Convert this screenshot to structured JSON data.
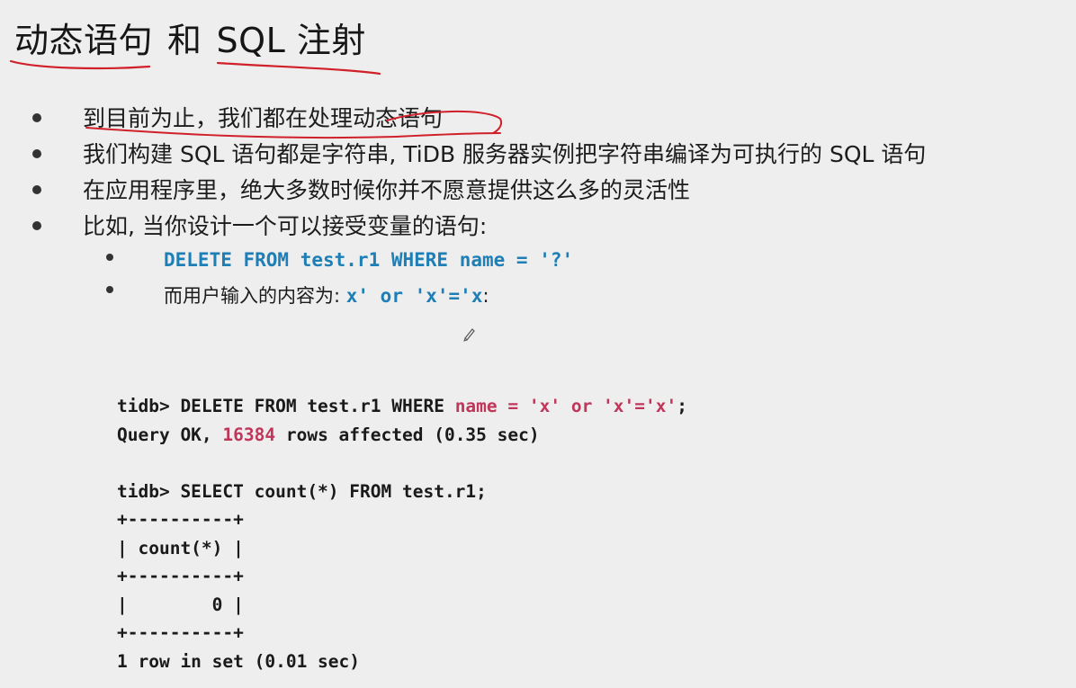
{
  "slide": {
    "title_part1": "动态语句",
    "title_part2": "和",
    "title_part3": "SQL 注射",
    "bullets": [
      "到目前为止，我们都在处理动态语句",
      "我们构建 SQL 语句都是字符串, TiDB 服务器实例把字符串编译为可执行的 SQL 语句",
      "在应用程序里，绝大多数时候你并不愿意提供这么多的灵活性",
      "比如, 当你设计一个可以接受变量的语句:"
    ],
    "sub_bullets": {
      "stmt": "DELETE FROM test.r1 WHERE name = '?'",
      "input_prefix": "而用户输入的内容为: ",
      "input_value": "x' or 'x'='x",
      "input_suffix": ":"
    }
  },
  "terminal": {
    "l1_prefix": "tidb> DELETE FROM test.r1 WHERE ",
    "l1_highlight": "name = 'x' or 'x'='x'",
    "l1_suffix": ";",
    "l2_prefix": "Query OK, ",
    "l2_count": "16384",
    "l2_suffix": " rows affected (0.35 sec)",
    "l3": "tidb> SELECT count(*) FROM test.r1;",
    "l4": "+----------+",
    "l5": "| count(*) |",
    "l6": "+----------+",
    "l7": "|        0 |",
    "l8": "+----------+",
    "l9": "1 row in set (0.01 sec)"
  },
  "colors": {
    "code_blue": "#1e7fb6",
    "highlight_red": "#c0365a",
    "annotation_red": "#d0202a"
  }
}
